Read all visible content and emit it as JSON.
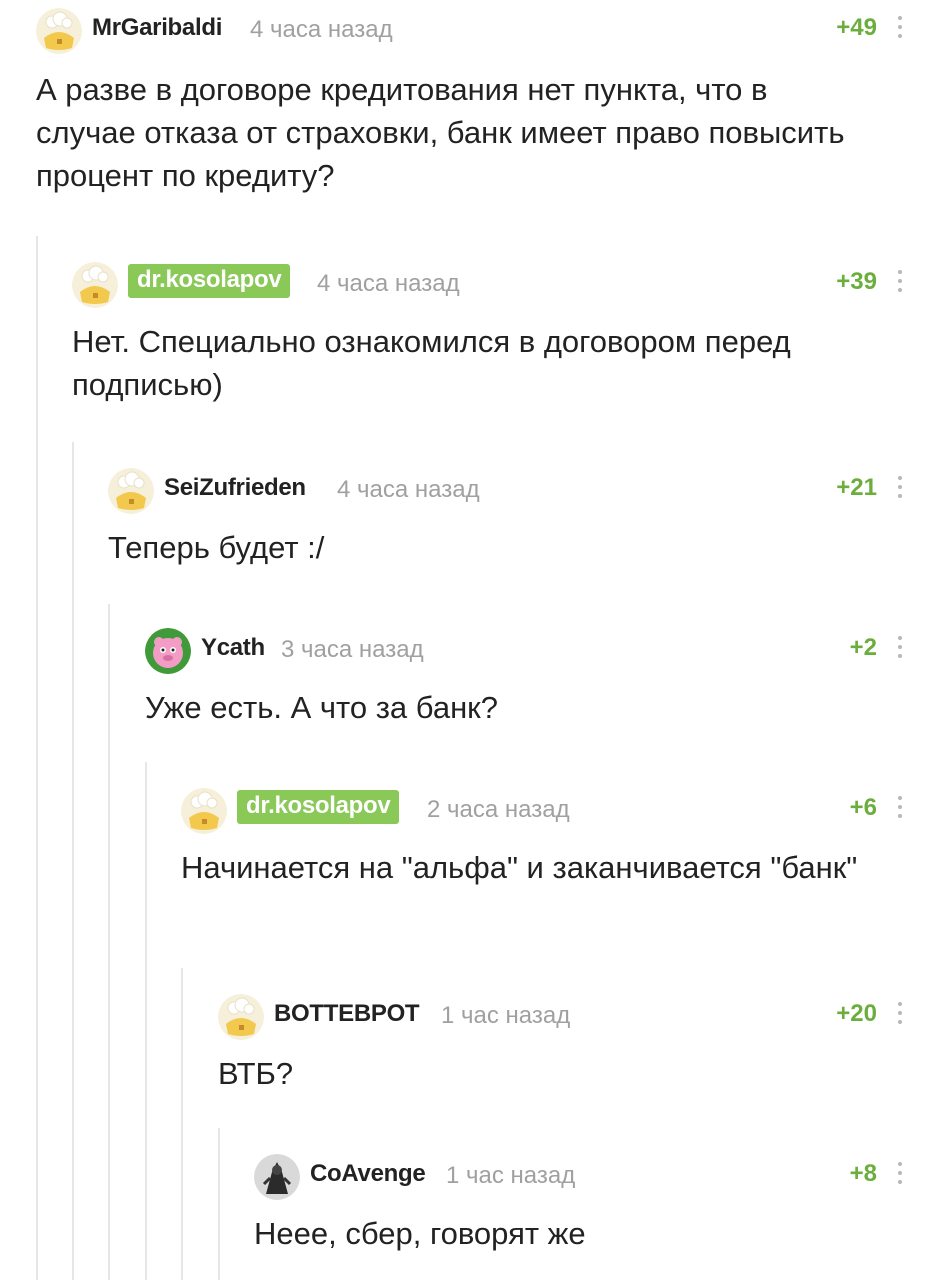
{
  "comments": [
    {
      "user": "MrGaribaldi",
      "time": "4 часа назад",
      "rating": "+49",
      "text": "А разве в договоре кредитования нет пункта, что в случае отказа от страховки, банк имеет право повысить процент по кредиту?",
      "is_author": false,
      "avatar": "default-avatar"
    },
    {
      "user": "dr.kosolapov",
      "time": "4 часа назад",
      "rating": "+39",
      "text": "Нет. Специально ознакомился в договором перед подписью)",
      "is_author": true,
      "avatar": "default-avatar"
    },
    {
      "user": "SeiZufrieden",
      "time": "4 часа назад",
      "rating": "+21",
      "text": "Теперь будет :/",
      "is_author": false,
      "avatar": "default-avatar"
    },
    {
      "user": "Ycath",
      "time": "3 часа назад",
      "rating": "+2",
      "text": "Уже есть. А что за банк?",
      "is_author": false,
      "avatar": "pink-character-avatar"
    },
    {
      "user": "dr.kosolapov",
      "time": "2 часа назад",
      "rating": "+6",
      "text": "Начинается на \"альфа\" и заканчивается \"банк\"",
      "is_author": true,
      "avatar": "default-avatar"
    },
    {
      "user": "BOTTEBPOT",
      "time": "1 час назад",
      "rating": "+20",
      "text": "ВТБ?",
      "is_author": false,
      "avatar": "default-avatar"
    },
    {
      "user": "CoAvenge",
      "time": "1 час назад",
      "rating": "+8",
      "text": "Неее, сбер, говорят же",
      "is_author": false,
      "avatar": "dark-photo-avatar"
    }
  ],
  "colors": {
    "rating": "#6cae3e",
    "author_badge": "#8ac858",
    "meta": "#a0a0a0",
    "branch_line": "#e6e6e6"
  }
}
